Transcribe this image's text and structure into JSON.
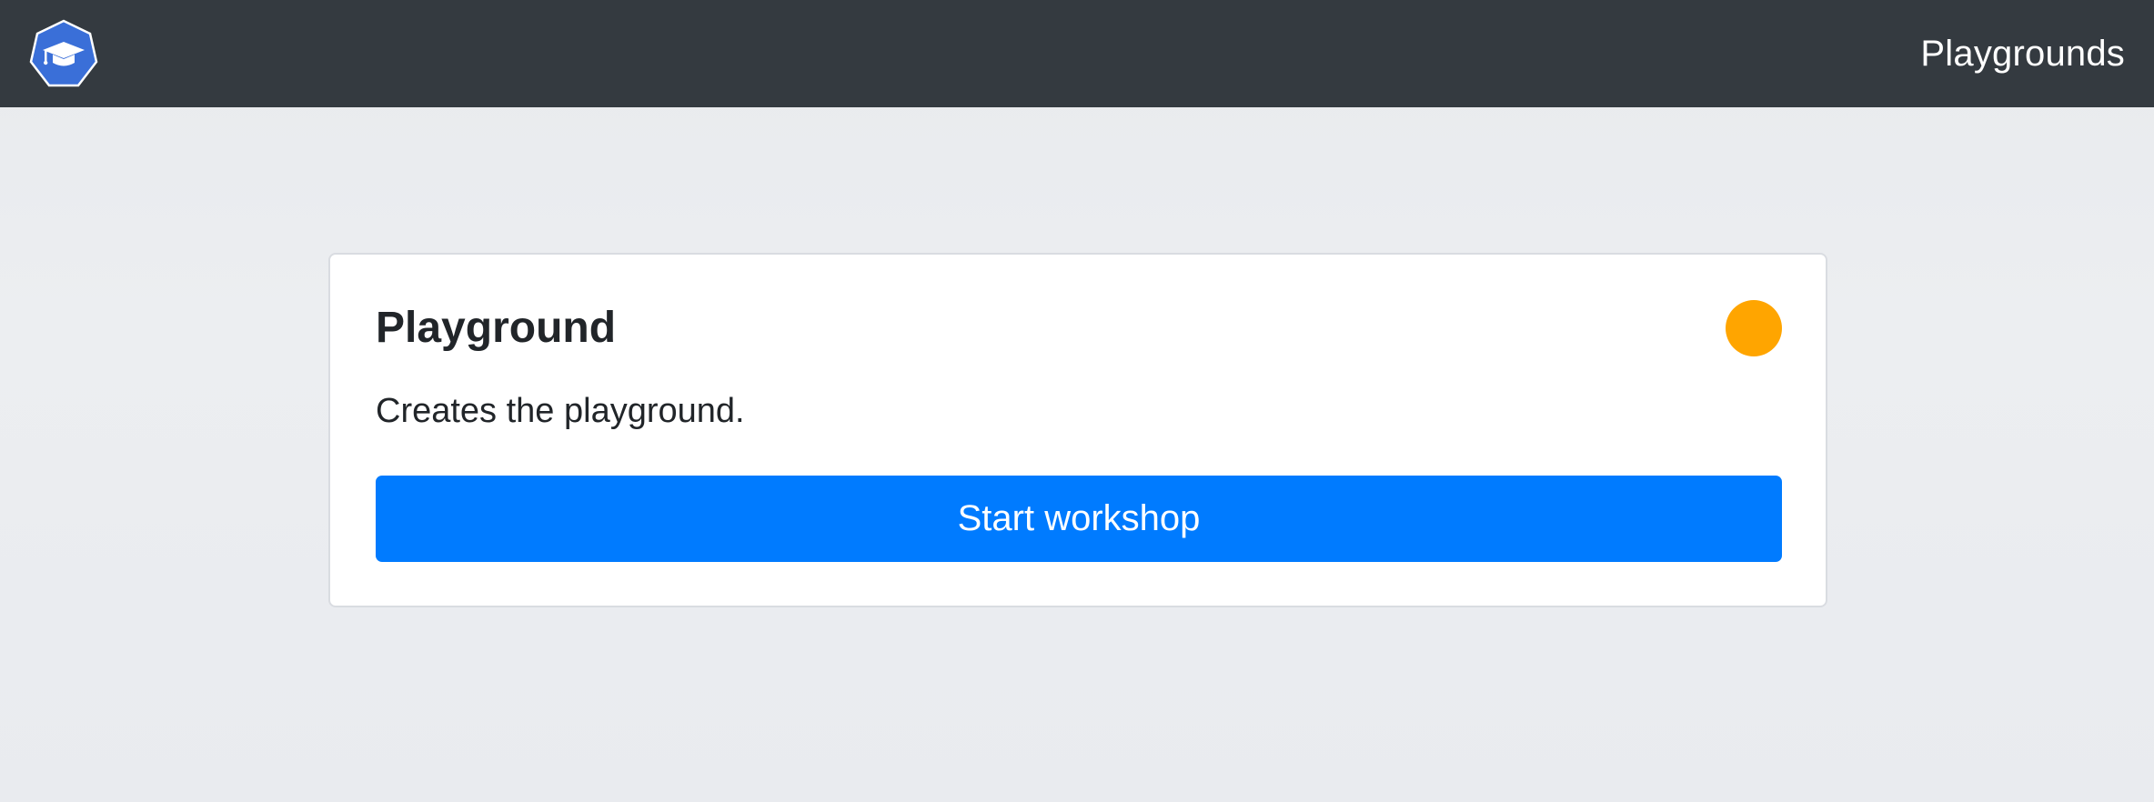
{
  "header": {
    "logo_icon": "graduation-cap-icon",
    "nav_link_label": "Playgrounds"
  },
  "card": {
    "title": "Playground",
    "description": "Creates the playground.",
    "status_color": "#ffa500",
    "button_label": "Start workshop",
    "button_color": "#007bff"
  },
  "colors": {
    "navbar": "#343a40",
    "logo": "#3a6fd8"
  }
}
